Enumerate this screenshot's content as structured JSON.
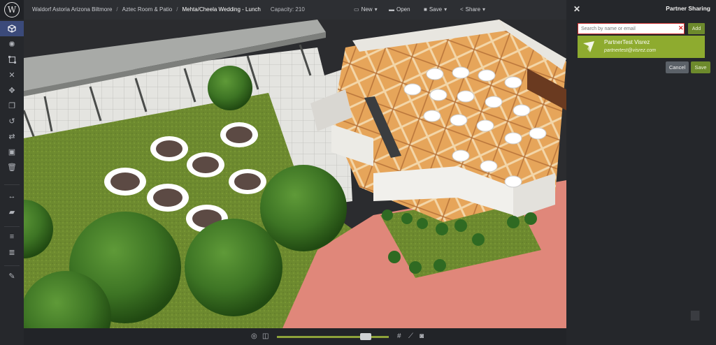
{
  "topbar": {
    "logo_letter": "W",
    "breadcrumbs": [
      "Waldorf Astoria Arizona Biltmore",
      "Aztec Room & Patio",
      "Mehta/Cheela Wedding - Lunch"
    ],
    "separator": "/",
    "capacity": "Capacity: 210",
    "menus": {
      "new": "New",
      "open": "Open",
      "save": "Save",
      "share": "Share"
    }
  },
  "toolbar_icons": [
    "cube-icon",
    "sun-icon",
    "select-box-icon",
    "close-icon",
    "move-icon",
    "copy-icon",
    "undo-icon",
    "swap-icon",
    "picture-icon",
    "trash-icon",
    "measure-icon",
    "ruler-icon",
    "align-top-icon",
    "align-bottom-icon",
    "edit-icon"
  ],
  "panel": {
    "title": "Partner Sharing",
    "search_placeholder": "Search by name or email",
    "add_label": "Add",
    "result": {
      "name": "PartnerTest Visrez",
      "email": "partnertest@visrez.com"
    },
    "cancel_label": "Cancel",
    "save_label": "Save"
  },
  "bottombar": {
    "icons": [
      "target-icon",
      "frame-icon",
      "grid-icon",
      "measure-icon",
      "camera-icon"
    ],
    "zoom_level_percent": 76
  },
  "colors": {
    "accent_green": "#8eab2f",
    "button_green": "#6d8a2c",
    "error_red": "#cc2b2b",
    "active_tool": "#3b4a7a"
  }
}
